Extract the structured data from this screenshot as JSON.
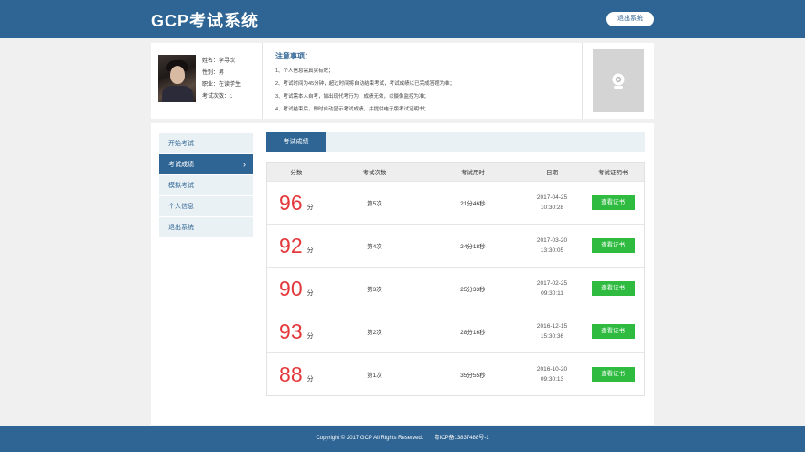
{
  "header": {
    "logo": "GCP考试系统",
    "logout_label": "退出系统"
  },
  "profile": {
    "name": "姓名：李寻欢",
    "gender": "性别：男",
    "job": "职业：在读学生",
    "exam_count": "考试次数：1"
  },
  "notice": {
    "title": "注意事项：",
    "items": [
      "1、个人信息需真实有效；",
      "2、考试时间为45分钟，超过时间将自动结束考试，考试成绩以已完成答题为准；",
      "3、考试需本人自考，如出现代考行为，成绩无效，以摄像监控为准；",
      "4、考试结束后，即时自动显示考试成绩，并提供电子版考试证明书；"
    ]
  },
  "sidebar": {
    "items": [
      {
        "label": "开始考试"
      },
      {
        "label": "考试成绩"
      },
      {
        "label": "模拟考试"
      },
      {
        "label": "个人信息"
      },
      {
        "label": "退出系统"
      }
    ]
  },
  "tab": {
    "label": "考试成绩"
  },
  "table": {
    "headers": [
      "分数",
      "考试次数",
      "考试用时",
      "日期",
      "考试证明书"
    ],
    "unit": "分",
    "button_label": "查看证书",
    "rows": [
      {
        "score": "96",
        "attempt": "第5次",
        "duration": "21分46秒",
        "date": "2017-04-25",
        "time": "10:30:28"
      },
      {
        "score": "92",
        "attempt": "第4次",
        "duration": "24分18秒",
        "date": "2017-03-20",
        "time": "13:30:05"
      },
      {
        "score": "90",
        "attempt": "第3次",
        "duration": "25分33秒",
        "date": "2017-02-25",
        "time": "09:30:11"
      },
      {
        "score": "93",
        "attempt": "第2次",
        "duration": "28分16秒",
        "date": "2016-12-15",
        "time": "15:30:36"
      },
      {
        "score": "88",
        "attempt": "第1次",
        "duration": "35分55秒",
        "date": "2016-10-20",
        "time": "09:30:13"
      }
    ]
  },
  "footer": {
    "copyright": "Copyright © 2017 GCP All Rights Reserved.",
    "icp": "粤ICP备13837488号-1"
  },
  "colors": {
    "brand": "#2f6594",
    "score": "#e4393c",
    "button": "#2ebb3f"
  }
}
